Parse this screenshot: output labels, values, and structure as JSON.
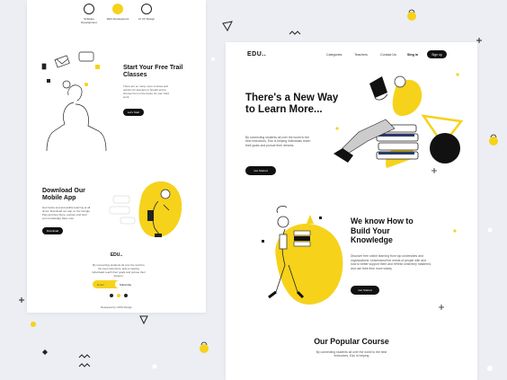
{
  "left_page": {
    "features": [
      {
        "label": "Software Development",
        "active": false
      },
      {
        "label": "Web Development",
        "active": true
      },
      {
        "label": "UI UX Design",
        "active": false
      }
    ],
    "trial": {
      "title": "Start Your Free Trail Classes",
      "text": "There are so many more courses and options for learners to benefit and to choose from in the future for your hard work.",
      "button": "Let's Start"
    },
    "app": {
      "title": "Download Our Mobile App",
      "text": "Get handy and accessible learning at all times. Download our app on the Google Play and App Store, explore and hold your knowledge base now.",
      "button": "Download"
    },
    "footer": {
      "logo": "EDU..",
      "text": "By connecting students all over the world to the best instructors, Edu is helping individuals reach their goals and pursue their dreams.",
      "email_placeholder": "Email",
      "subscribe": "Subscribe",
      "copyright": "Designed by UIXD Design"
    }
  },
  "right_page": {
    "logo": "EDU..",
    "nav_links": [
      "Categories",
      "Teachers",
      "Contact Us"
    ],
    "sign_in": "Sing in",
    "sign_up": "Sign up",
    "hero": {
      "title": "There's a New Way to Learn More...",
      "text": "By connecting students all over the world to the best instructors, Edu is helping individuals reach their goals and pursue their dreams.",
      "button": "Get Started"
    },
    "knowledge": {
      "title": "We know How to Build Your Knowledge",
      "text": "Discover free online learning from top universities and organizations. Understand the needs of people with and how to better support them and refresh what they mastered, and use their time more wisely.",
      "button": "Get Started"
    },
    "popular": {
      "title": "Our Popular Course",
      "text": "By connecting students all over the world to the best instructors, Edu is helping"
    }
  },
  "colors": {
    "accent": "#f6d21b",
    "dark": "#111111",
    "background": "#eceef3"
  }
}
